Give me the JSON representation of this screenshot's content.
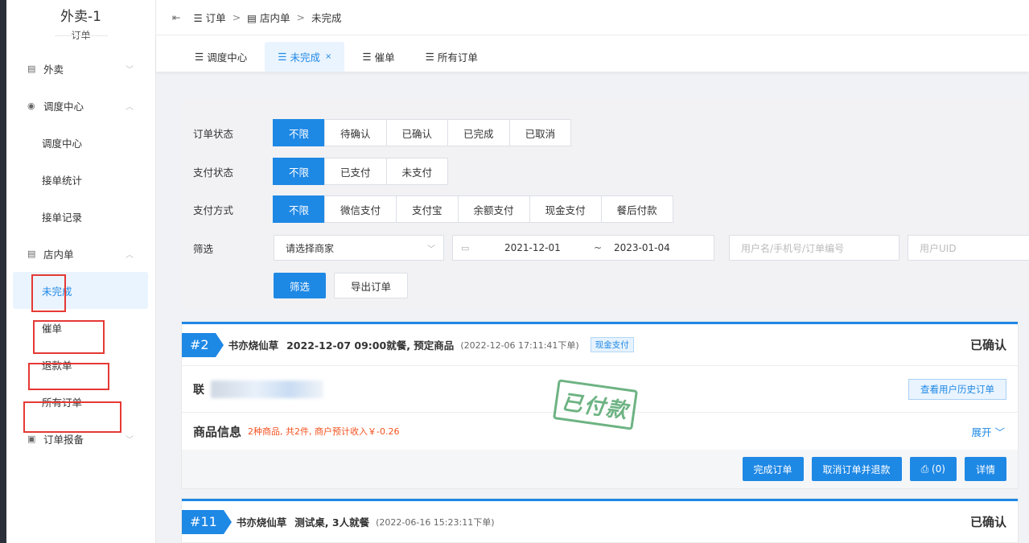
{
  "sidebar": {
    "app_title": "外卖-1",
    "app_subtitle": "订单",
    "items": [
      {
        "label": "外卖",
        "icon": "document-icon",
        "chevron": "chevron-down-icon"
      },
      {
        "label": "调度中心",
        "icon": "location-icon",
        "chevron": "chevron-up-icon"
      },
      {
        "label": "调度中心"
      },
      {
        "label": "接单统计"
      },
      {
        "label": "接单记录"
      },
      {
        "label": "店内单",
        "icon": "document-icon",
        "chevron": "chevron-up-icon"
      },
      {
        "label": "未完成",
        "active": true
      },
      {
        "label": "催单"
      },
      {
        "label": "退款单"
      },
      {
        "label": "所有订单"
      },
      {
        "label": "订单报备",
        "icon": "report-icon",
        "chevron": "chevron-down-icon"
      }
    ]
  },
  "header": {
    "breadcrumb": [
      "订单",
      "店内单",
      "未完成"
    ],
    "separator": ">"
  },
  "tabs": [
    {
      "label": "调度中心"
    },
    {
      "label": "未完成",
      "active": true,
      "close": "×"
    },
    {
      "label": "催单"
    },
    {
      "label": "所有订单"
    }
  ],
  "filter": {
    "order_status": {
      "label": "订单状态",
      "options": [
        "不限",
        "待确认",
        "已确认",
        "已完成",
        "已取消"
      ],
      "selected": "不限"
    },
    "pay_status": {
      "label": "支付状态",
      "options": [
        "不限",
        "已支付",
        "未支付"
      ],
      "selected": "不限"
    },
    "pay_method": {
      "label": "支付方式",
      "options": [
        "不限",
        "微信支付",
        "支付宝",
        "余额支付",
        "现金支付",
        "餐后付款"
      ],
      "selected": "不限"
    },
    "screen": {
      "label": "筛选",
      "merchant_select": "请选择商家",
      "date_start": "2021-12-01",
      "date_sep": "~",
      "date_end": "2023-01-04",
      "search_placeholder": "用户名/手机号/订单编号",
      "uid_placeholder": "用户UID"
    },
    "filter_button": "筛选",
    "export_button": "导出订单"
  },
  "orders": [
    {
      "number": "#2",
      "shop": "书亦烧仙草",
      "when": "2022-12-07 09:00就餐, 预定商品",
      "placed": "(2022-12-06 17:11:41下单)",
      "pay_tag": "现金支付",
      "status": "已确认",
      "contact_prefix": "联",
      "history_button": "查看用户历史订单",
      "goods_title": "商品信息",
      "goods_note": "2种商品, 共2件, 商户预计收入￥-0.26",
      "expand": "展开",
      "stamp": "已付款",
      "actions": [
        "完成订单",
        "取消订单并退款",
        "⎙ (0)",
        "详情"
      ]
    },
    {
      "number": "#11",
      "shop": "书亦烧仙草",
      "when": "测试桌, 3人就餐",
      "placed": "(2022-06-16 15:23:11下单)",
      "status": "已确认"
    }
  ],
  "colors": {
    "primary": "#1e88e5",
    "highlight_box": "#e53935",
    "stamp": "#3d9a5a",
    "warning_text": "#f4511e"
  }
}
